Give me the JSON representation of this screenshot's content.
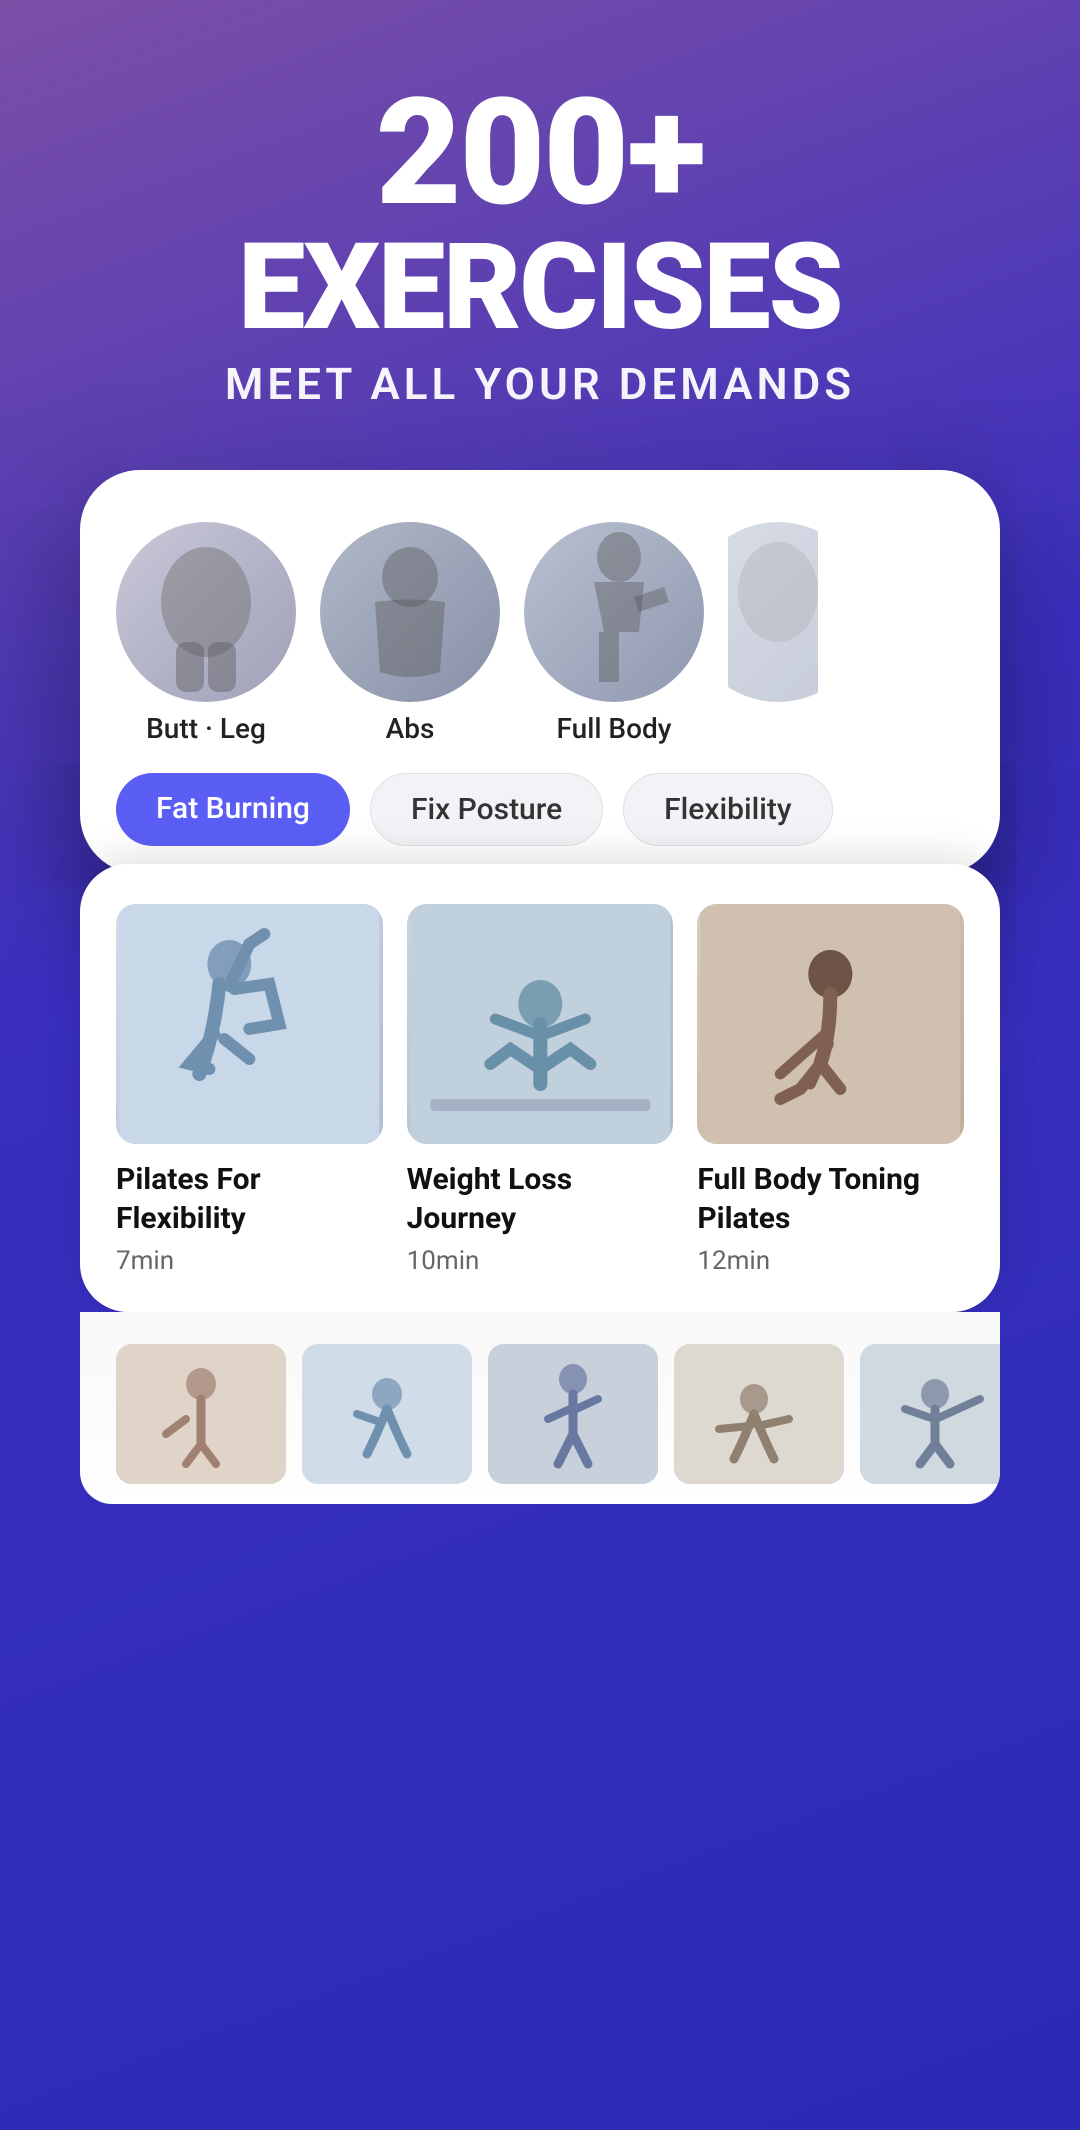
{
  "hero": {
    "number": "200+",
    "title": "EXERCISES",
    "subtitle": "MEET ALL YOUR DEMANDS"
  },
  "categories": [
    {
      "id": "butt-leg",
      "label": "Butt · Leg"
    },
    {
      "id": "abs",
      "label": "Abs"
    },
    {
      "id": "full-body",
      "label": "Full Body"
    },
    {
      "id": "partial",
      "label": "..."
    }
  ],
  "filters": [
    {
      "id": "fat-burning",
      "label": "Fat Burning",
      "active": true
    },
    {
      "id": "fix-posture",
      "label": "Fix Posture",
      "active": false
    },
    {
      "id": "flexibility",
      "label": "Flexibility",
      "active": false
    }
  ],
  "workouts": [
    {
      "id": "pilates-flexibility",
      "title": "Pilates For Flexibility",
      "duration": "7min"
    },
    {
      "id": "weight-loss-journey",
      "title": "Weight Loss Journey",
      "duration": "10min"
    },
    {
      "id": "full-body-toning",
      "title": "Full Body Toning Pilates",
      "duration": "12min"
    }
  ],
  "thumbnails": [
    {
      "id": "t1"
    },
    {
      "id": "t2"
    },
    {
      "id": "t3"
    },
    {
      "id": "t4"
    },
    {
      "id": "t5"
    }
  ]
}
